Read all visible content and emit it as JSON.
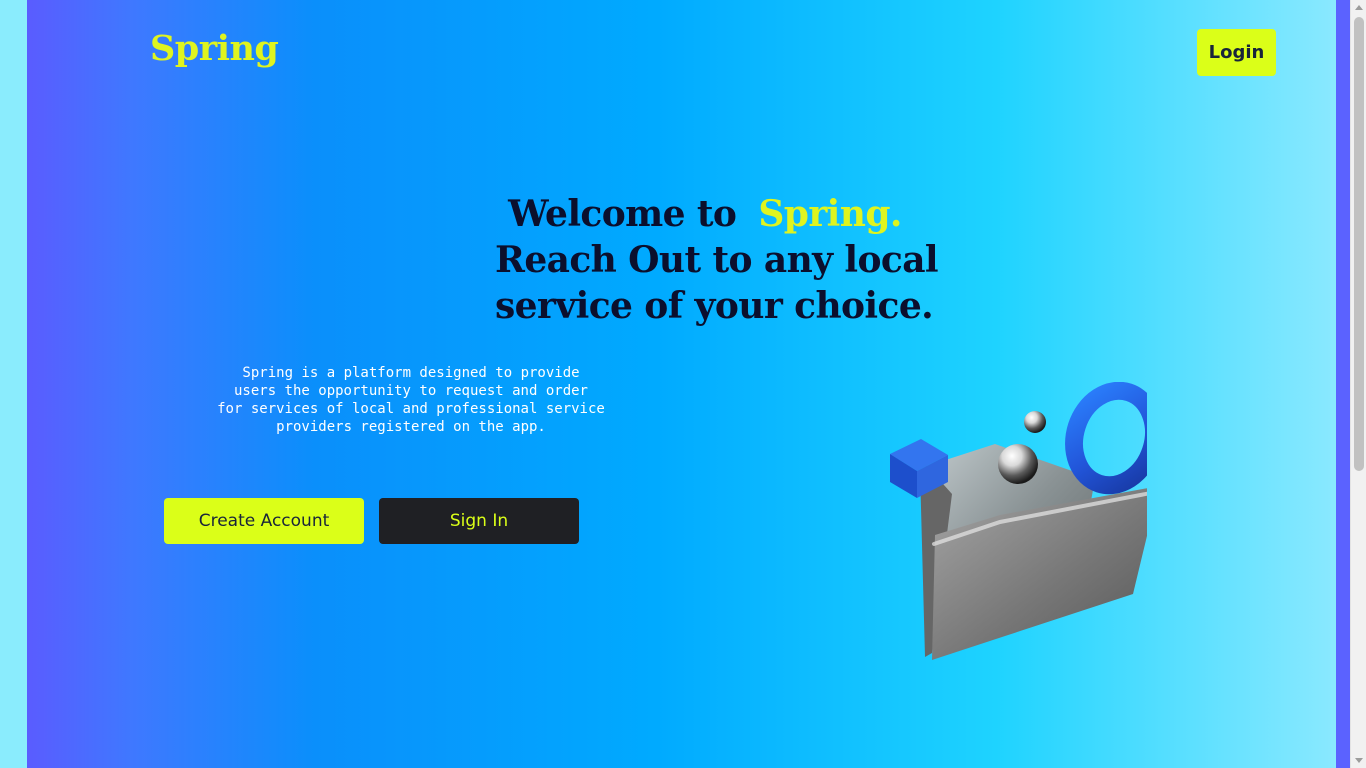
{
  "brand": {
    "logo": "Spring"
  },
  "header": {
    "login_label": "Login"
  },
  "hero": {
    "line_prefix": "Welcome to",
    "highlight": "Spring.",
    "line_2": "Reach Out to any local",
    "line_3": "service of your choice."
  },
  "description": {
    "lines": [
      "Spring is a platform designed to provide",
      "users the opportunity to request and order",
      "for services of local and professional service",
      "providers registered on the app."
    ]
  },
  "actions": {
    "create_account_label": "Create Account",
    "sign_in_label": "Sign In"
  },
  "illustration": {
    "icon": "folder-icon"
  },
  "colors": {
    "accent": "#dbff18",
    "dark_button": "#1f2024",
    "gradient_start": "#5a5cff",
    "gradient_end": "#8ae9ff"
  }
}
